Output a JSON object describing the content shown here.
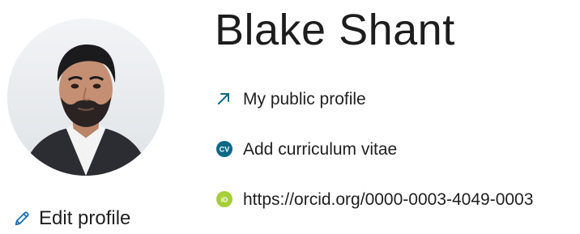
{
  "profile": {
    "name": "Blake Shant",
    "edit_label": "Edit profile"
  },
  "links": {
    "public_profile": "My public profile",
    "cv": "Add curriculum vitae",
    "orcid": "https://orcid.org/0000-0003-4049-0003"
  },
  "icons": {
    "public_profile": "external-arrow-icon",
    "cv": "cv-icon",
    "orcid": "orcid-icon",
    "edit": "pencil-icon"
  },
  "colors": {
    "cv_badge": "#0b6a84",
    "orcid_badge": "#a6ce39",
    "link_arrow": "#0b6a84",
    "edit_icon": "#1f6fb2",
    "text": "#1f1f1f"
  }
}
